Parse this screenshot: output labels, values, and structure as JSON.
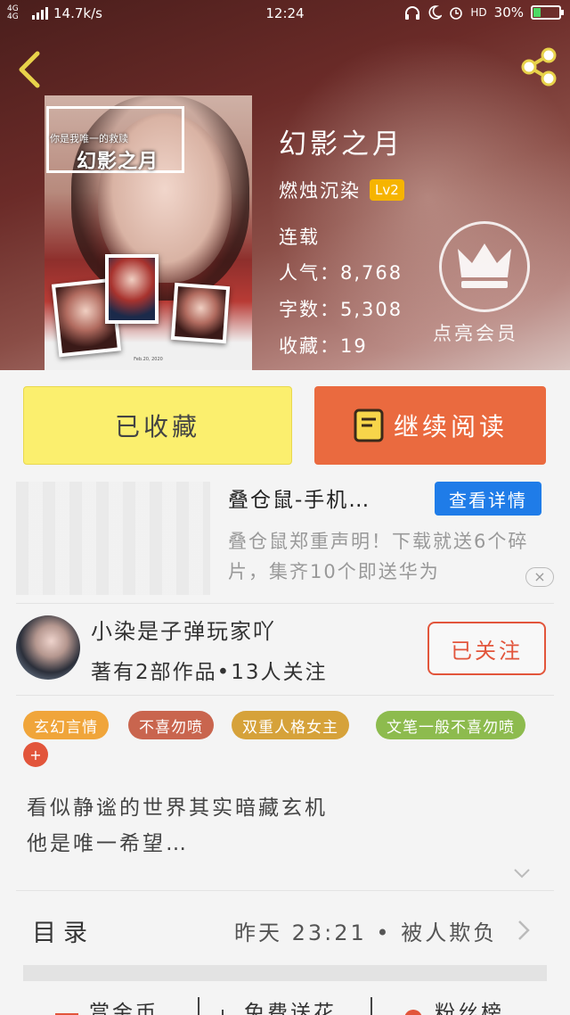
{
  "status_bar": {
    "network": "4G 4G",
    "speed": "14.7k/s",
    "time": "12:24",
    "hd": "HD",
    "battery": "30%",
    "battery_level": 0.3
  },
  "book": {
    "cover_tagline": "你是我唯一的救赎",
    "cover_title": "幻影之月",
    "cover_footer": "Feb.20, 2020",
    "title": "幻影之月",
    "author": "燃烛沉染",
    "level": "Lv2",
    "status": "连载",
    "popularity": "人气：8,768",
    "word_count": "字数：5,308",
    "favorites": "收藏：19",
    "vip_label": "点亮会员"
  },
  "actions": {
    "collected": "已收藏",
    "continue_reading": "继续阅读"
  },
  "ad": {
    "title": "叠仓鼠-手机…",
    "detail_button": "查看详情",
    "desc": "叠仓鼠郑重声明！下载就送6个碎片，集齐10个即送华为",
    "close": "×"
  },
  "user": {
    "name": "小染是子弹玩家吖",
    "meta": "著有2部作品•13人关注",
    "follow_button": "已关注"
  },
  "tags": [
    {
      "label": "玄幻言情",
      "color": "#f0a53a"
    },
    {
      "label": "不喜勿喷",
      "color": "#c9654e"
    },
    {
      "label": "双重人格女主",
      "color": "#d6a23a"
    },
    {
      "label": "文笔一般不喜勿喷",
      "color": "#8dbb4e"
    }
  ],
  "tag_add": "+",
  "synopsis": {
    "line1": "看似静谧的世界其实暗藏玄机",
    "line2": "他是唯一希望…"
  },
  "toc": {
    "label": "目录",
    "latest": "昨天 23:21 • 被人欺负"
  },
  "bottom": {
    "item1": "赏金币",
    "item2": "免费送花",
    "item3": "粉丝榜"
  },
  "colors": {
    "accent": "#ea6a3f",
    "collected_bg": "#fbef6e",
    "detail_blue": "#1f7ce8",
    "follow_red": "#e2553b"
  }
}
